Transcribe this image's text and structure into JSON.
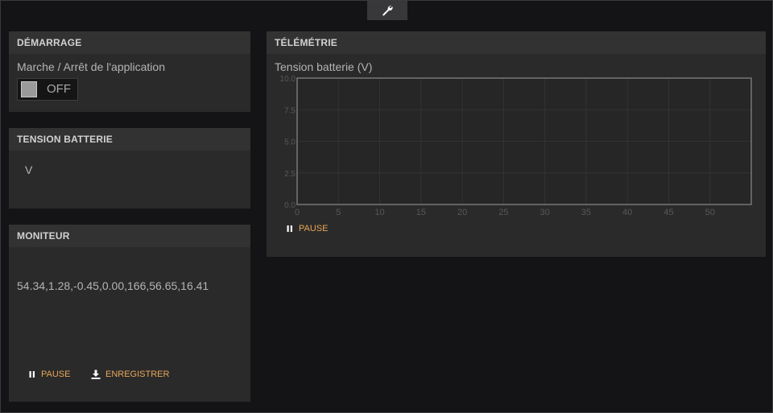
{
  "toolbar": {
    "settings_icon": "wrench-icon"
  },
  "startup": {
    "title": "DÉMARRAGE",
    "label": "Marche / Arrêt de l'application",
    "toggle_state": "OFF"
  },
  "voltage": {
    "title": "TENSION BATTERIE",
    "value": "",
    "unit": "V"
  },
  "monitor": {
    "title": "MONITEUR",
    "line": "54.34,1.28,-0.45,0.00,166,56.65,16.41",
    "pause_label": "PAUSE",
    "save_label": "ENREGISTRER"
  },
  "telemetry": {
    "title": "TÉLÉMÉTRIE",
    "pause_label": "PAUSE"
  },
  "colors": {
    "accent": "#e8a65a",
    "panel": "#2a2a2a",
    "panel_header": "#323232",
    "background": "#141416"
  },
  "chart_data": {
    "type": "line",
    "title": "Tension batterie (V)",
    "xlabel": "",
    "ylabel": "",
    "xlim": [
      0,
      55
    ],
    "ylim": [
      0,
      10
    ],
    "x_ticks": [
      "0",
      "5",
      "10",
      "15",
      "20",
      "25",
      "30",
      "35",
      "40",
      "45",
      "50"
    ],
    "y_ticks": [
      "10.0",
      "7.5",
      "5.0",
      "2.5",
      "0.0"
    ],
    "series": [],
    "grid": true
  }
}
